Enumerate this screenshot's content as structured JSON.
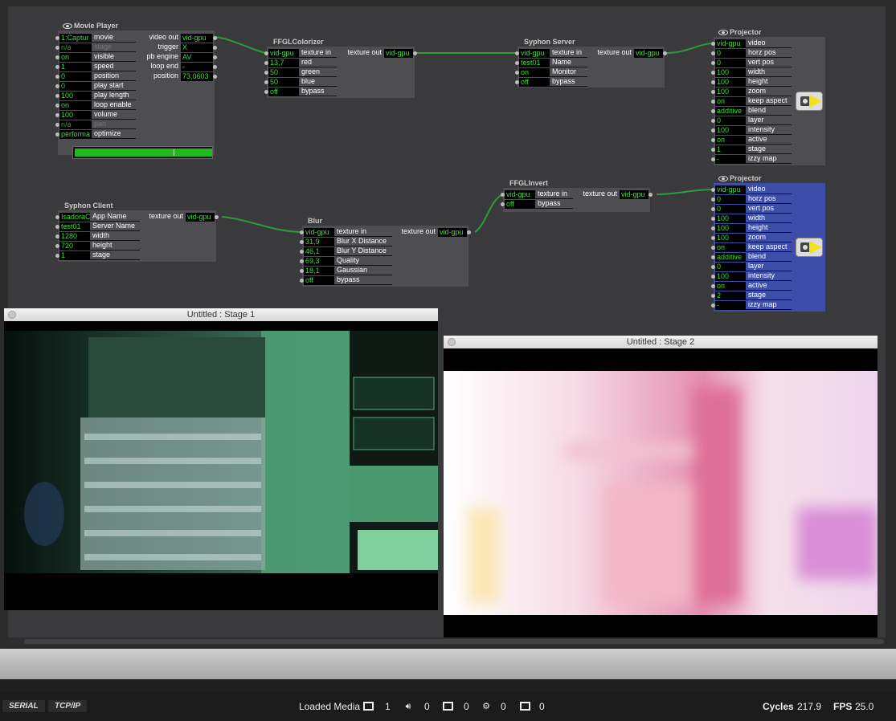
{
  "actors": {
    "movie_player": {
      "title": "Movie Player",
      "inputs": [
        {
          "value": "1:Captur",
          "label": "movie"
        },
        {
          "value": "n/a",
          "label": "stage"
        },
        {
          "value": "on",
          "label": "visible"
        },
        {
          "value": "1",
          "label": "speed"
        },
        {
          "value": "0",
          "label": "position"
        },
        {
          "value": "0",
          "label": "play start"
        },
        {
          "value": "100",
          "label": "play length"
        },
        {
          "value": "on",
          "label": "loop enable"
        },
        {
          "value": "100",
          "label": "volume"
        },
        {
          "value": "n/a",
          "label": "pan"
        },
        {
          "value": "performa",
          "label": "optimize"
        }
      ],
      "outputs": [
        {
          "label": "video out",
          "value": "vid-gpu"
        },
        {
          "label": "trigger",
          "value": "X"
        },
        {
          "label": "pb engine",
          "value": "AV"
        },
        {
          "label": "loop end",
          "value": "-"
        },
        {
          "label": "position",
          "value": "73,0603"
        }
      ],
      "progress": 0.72
    },
    "ffgl_colorizer": {
      "title": "FFGLColorizer",
      "inputs": [
        {
          "value": "vid-gpu",
          "label": "texture in"
        },
        {
          "value": "13,7",
          "label": "red"
        },
        {
          "value": "50",
          "label": "green"
        },
        {
          "value": "50",
          "label": "blue"
        },
        {
          "value": "off",
          "label": "bypass"
        }
      ],
      "outputs": [
        {
          "label": "texture out",
          "value": "vid-gpu"
        }
      ]
    },
    "syphon_server": {
      "title": "Syphon Server",
      "inputs": [
        {
          "value": "vid-gpu",
          "label": "texture in"
        },
        {
          "value": "test01",
          "label": "Name"
        },
        {
          "value": "on",
          "label": "Monitor"
        },
        {
          "value": "off",
          "label": "bypass"
        }
      ],
      "outputs": [
        {
          "label": "texture out",
          "value": "vid-gpu"
        }
      ]
    },
    "projector_1": {
      "title": "Projector",
      "inputs": [
        {
          "value": "vid-gpu",
          "label": "video"
        },
        {
          "value": "0",
          "label": "horz pos"
        },
        {
          "value": "0",
          "label": "vert pos"
        },
        {
          "value": "100",
          "label": "width"
        },
        {
          "value": "100",
          "label": "height"
        },
        {
          "value": "100",
          "label": "zoom"
        },
        {
          "value": "on",
          "label": "keep aspect"
        },
        {
          "value": "additive",
          "label": "blend"
        },
        {
          "value": "0",
          "label": "layer"
        },
        {
          "value": "100",
          "label": "intensity"
        },
        {
          "value": "on",
          "label": "active"
        },
        {
          "value": "1",
          "label": "stage"
        },
        {
          "value": "-",
          "label": "izzy map"
        }
      ]
    },
    "syphon_client": {
      "title": "Syphon Client",
      "inputs": [
        {
          "value": "IsadoraC",
          "label": "App Name"
        },
        {
          "value": "test01",
          "label": "Server Name"
        },
        {
          "value": "1280",
          "label": "width"
        },
        {
          "value": "720",
          "label": "height"
        },
        {
          "value": "1",
          "label": "stage"
        }
      ],
      "outputs": [
        {
          "label": "texture out",
          "value": "vid-gpu"
        }
      ]
    },
    "blur": {
      "title": "Blur",
      "inputs": [
        {
          "value": "vid-gpu",
          "label": "texture in"
        },
        {
          "value": "31,9",
          "label": "Blur X Distance"
        },
        {
          "value": "46,1",
          "label": "Blur Y Distance"
        },
        {
          "value": "69,3",
          "label": "Quality"
        },
        {
          "value": "18,1",
          "label": "Gaussian"
        },
        {
          "value": "off",
          "label": "bypass"
        }
      ],
      "outputs": [
        {
          "label": "texture out",
          "value": "vid-gpu"
        }
      ]
    },
    "ffgl_invert": {
      "title": "FFGLInvert",
      "inputs": [
        {
          "value": "vid-gpu",
          "label": "texture in"
        },
        {
          "value": "off",
          "label": "bypass"
        }
      ],
      "outputs": [
        {
          "label": "texture out",
          "value": "vid-gpu"
        }
      ]
    },
    "projector_2": {
      "title": "Projector",
      "inputs": [
        {
          "value": "vid-gpu",
          "label": "video"
        },
        {
          "value": "0",
          "label": "horz pos"
        },
        {
          "value": "0",
          "label": "vert pos"
        },
        {
          "value": "100",
          "label": "width"
        },
        {
          "value": "100",
          "label": "height"
        },
        {
          "value": "100",
          "label": "zoom"
        },
        {
          "value": "on",
          "label": "keep aspect"
        },
        {
          "value": "additive",
          "label": "blend"
        },
        {
          "value": "0",
          "label": "layer"
        },
        {
          "value": "100",
          "label": "intensity"
        },
        {
          "value": "on",
          "label": "active"
        },
        {
          "value": "2",
          "label": "stage"
        },
        {
          "value": "-",
          "label": "izzy map"
        }
      ]
    }
  },
  "stages": {
    "stage1": {
      "title": "Untitled : Stage 1"
    },
    "stage2": {
      "title": "Untitled : Stage 2"
    }
  },
  "status_bar": {
    "serial_label": "SERIAL",
    "tcpip_label": "TCP/IP",
    "loaded_media_label": "Loaded Media",
    "video_count": "1",
    "audio_count": "0",
    "picture_count": "0",
    "misc_count": "0",
    "3d_count": "0",
    "cycles_label": "Cycles",
    "cycles_value": "217.9",
    "fps_label": "FPS",
    "fps_value": "25.0"
  },
  "colors": {
    "value_text": "#3ddc3d",
    "wire": "#2e9b3a",
    "selected_actor": "#3d4ea8"
  }
}
